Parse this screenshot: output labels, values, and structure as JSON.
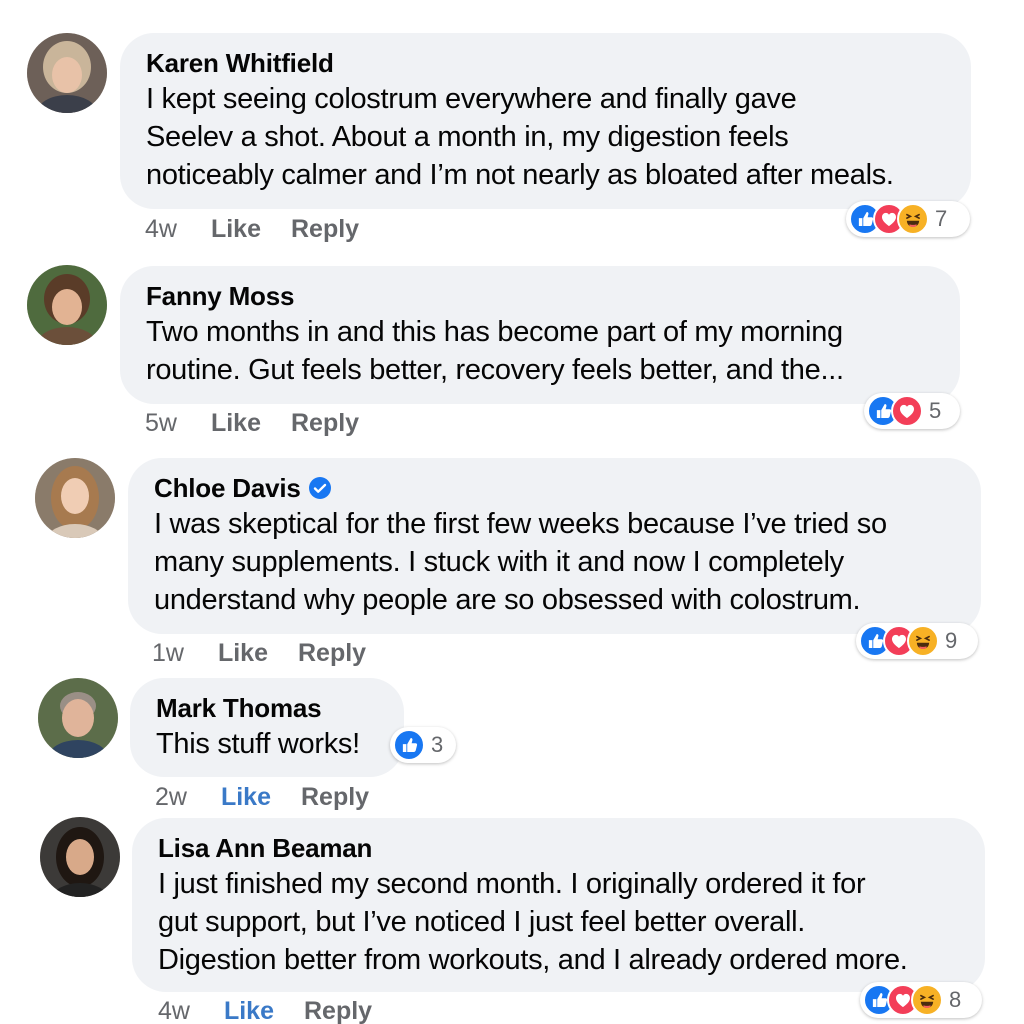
{
  "comments": [
    {
      "author": "Karen Whitfield",
      "lines": [
        "I kept seeing colostrum everywhere and finally gave",
        "Seelev a shot. About a month in, my digestion feels",
        "noticeably calmer and I’m not nearly as bloated after meals."
      ],
      "time": "4w",
      "like_label": "Like",
      "reply_label": "Reply",
      "reactions": [
        "like-icon",
        "love-icon",
        "haha-icon"
      ],
      "reaction_count": "7",
      "verified": false,
      "liked": false
    },
    {
      "author": "Fanny Moss",
      "lines": [
        "Two months in and this has become part of my morning",
        "routine. Gut feels better, recovery feels better, and the..."
      ],
      "time": "5w",
      "like_label": "Like",
      "reply_label": "Reply",
      "reactions": [
        "like-icon",
        "love-icon"
      ],
      "reaction_count": "5",
      "verified": false,
      "liked": false
    },
    {
      "author": "Chloe Davis",
      "lines": [
        "I was skeptical for the first few weeks because I’ve tried so",
        "many supplements. I stuck with it and now I completely",
        "understand why people are so obsessed with colostrum."
      ],
      "time": "1w",
      "like_label": "Like",
      "reply_label": "Reply",
      "reactions": [
        "like-icon",
        "love-icon",
        "haha-icon"
      ],
      "reaction_count": "9",
      "verified": true,
      "liked": false
    },
    {
      "author": "Mark Thomas",
      "lines": [
        "This stuff works!"
      ],
      "time": "2w",
      "like_label": "Like",
      "reply_label": "Reply",
      "reactions": [
        "like-icon"
      ],
      "reaction_count": "3",
      "verified": false,
      "liked": true
    },
    {
      "author": "Lisa Ann Beaman",
      "lines": [
        "I just finished my second month. I originally ordered it for",
        "gut support, but I’ve noticed I just feel better overall.",
        "Digestion better from workouts, and I already ordered more."
      ],
      "time": "4w",
      "like_label": "Like",
      "reply_label": "Reply",
      "reactions": [
        "like-icon",
        "love-icon",
        "haha-icon"
      ],
      "reaction_count": "8",
      "verified": false,
      "liked": true
    }
  ],
  "colors": {
    "bubble_bg": "#f0f2f5",
    "meta_text": "#65676b",
    "like_active": "#3a79c7",
    "like_reaction": "#1877f2",
    "love_reaction": "#f33e58",
    "haha_reaction": "#f7b125",
    "verified_badge": "#1877f2"
  }
}
